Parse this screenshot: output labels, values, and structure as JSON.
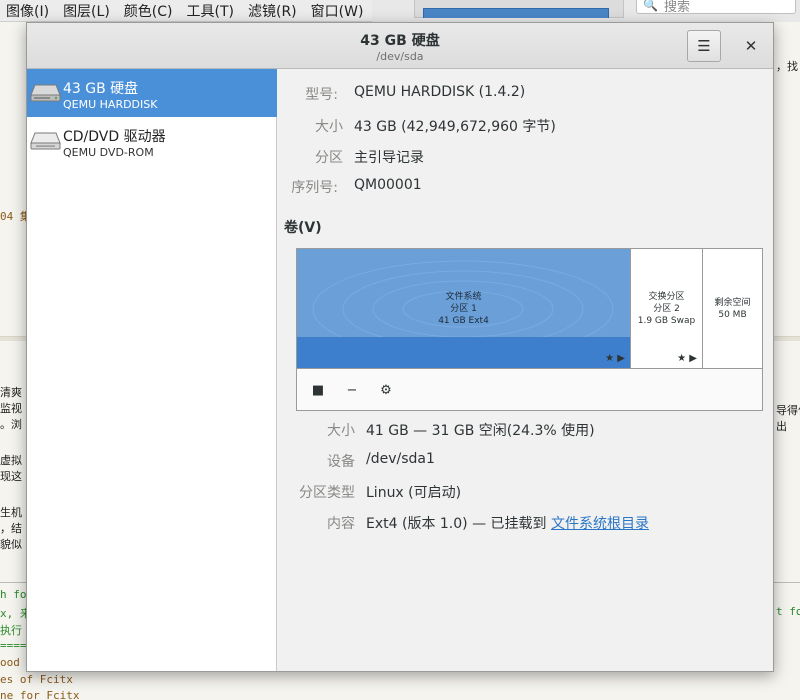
{
  "background": {
    "menubar": [
      "图像(I)",
      "图层(L)",
      "颜色(C)",
      "工具(T)",
      "滤镜(R)",
      "窗口(W)"
    ],
    "search_placeholder": "搜索",
    "fragments": {
      "l1": "，找",
      "l2": "04 集",
      "l3": "清爽",
      "l4": "监视",
      "l5": "。浏",
      "l6": "虚拟",
      "l7": "现这",
      "l8": "生机",
      "l9": "，结",
      "l10": "貌似",
      "r1": "导得住",
      "r2": "出",
      "c1": "h fo",
      "c2": "x, 来",
      "c3": "执行",
      "c4": "====",
      "c5": "ood f",
      "c6": "es of Fcitx",
      "c7": "ne for Fcitx",
      "c8": "t fo"
    }
  },
  "dialog": {
    "title": "43 GB 硬盘",
    "subtitle": "/dev/sda",
    "menu_icon": "☰",
    "close_icon": "✕"
  },
  "drives": [
    {
      "name": "43 GB 硬盘",
      "model": "QEMU HARDDISK",
      "icon": "harddisk-icon",
      "selected": true
    },
    {
      "name": "CD/DVD 驱动器",
      "model": "QEMU DVD-ROM",
      "icon": "optical-drive-icon",
      "selected": false
    }
  ],
  "disk_info": {
    "model_label": "型号:",
    "model_value": "QEMU HARDDISK (1.4.2)",
    "size_label": "大小",
    "size_value": "43 GB (42,949,672,960 字节)",
    "partition_label": "分区",
    "partition_value": "主引导记录",
    "serial_label": "序列号:",
    "serial_value": "QM00001"
  },
  "volumes": {
    "title": "卷(V)",
    "segments": [
      {
        "line1": "文件系统",
        "line2": "分区 1",
        "line3": "41 GB Ext4",
        "selected": true,
        "share_fraction": 0.715
      },
      {
        "line1": "交换分区",
        "line2": "分区 2",
        "line3": "1.9 GB Swap",
        "selected": false,
        "share_fraction": 0.155
      },
      {
        "line1": "剩余空间",
        "line2": "50 MB",
        "selected": false,
        "share_fraction": 0.13
      }
    ],
    "mark_glyphs": "★ ▶",
    "toolbar": {
      "stop_icon": "■",
      "delete_icon": "−",
      "settings_icon": "⚙"
    }
  },
  "volume_info": {
    "size_label": "大小",
    "size_value": "41 GB — 31 GB 空闲(24.3% 使用)",
    "device_label": "设备",
    "device_value": "/dev/sda1",
    "ptype_label": "分区类型",
    "ptype_value": "Linux (可启动)",
    "content_label": "内容",
    "content_value_prefix": "Ext4 (版本 1.0) — 已挂载到 ",
    "content_link": "文件系统根目录"
  },
  "colors": {
    "selection": "#4a90d9",
    "volume_fill": "#6a9fd8",
    "link": "#2a76c6"
  }
}
